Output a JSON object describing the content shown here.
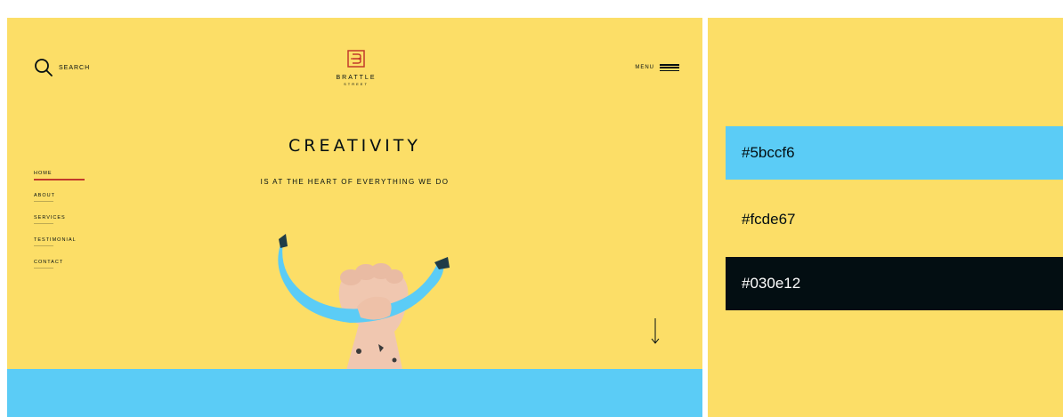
{
  "site": {
    "search_label": "SEARCH",
    "logo_name": "BRATTLE",
    "logo_sub": "STREET",
    "menu_label": "MENU",
    "headline": "CREATIVITY",
    "subhead": "IS AT THE HEART OF EVERYTHING WE DO",
    "nav": [
      {
        "label": "HOME",
        "active": true
      },
      {
        "label": "ABOUT"
      },
      {
        "label": "SERVICES"
      },
      {
        "label": "TESTIMONIAL"
      },
      {
        "label": "CONTACT"
      }
    ]
  },
  "palette": {
    "swatches": [
      {
        "label": "#5bccf6",
        "color": "#5bccf6"
      },
      {
        "label": "#fcde67",
        "color": "#fcde67"
      },
      {
        "label": "#030e12",
        "color": "#030e12"
      }
    ]
  },
  "colors": {
    "yellow": "#fcde67",
    "blue": "#5bccf6",
    "dark": "#030e12",
    "logo_red": "#c23a2b"
  },
  "icons": [
    "search-icon",
    "logo-icon",
    "hamburger-menu-icon",
    "down-arrow-icon"
  ]
}
